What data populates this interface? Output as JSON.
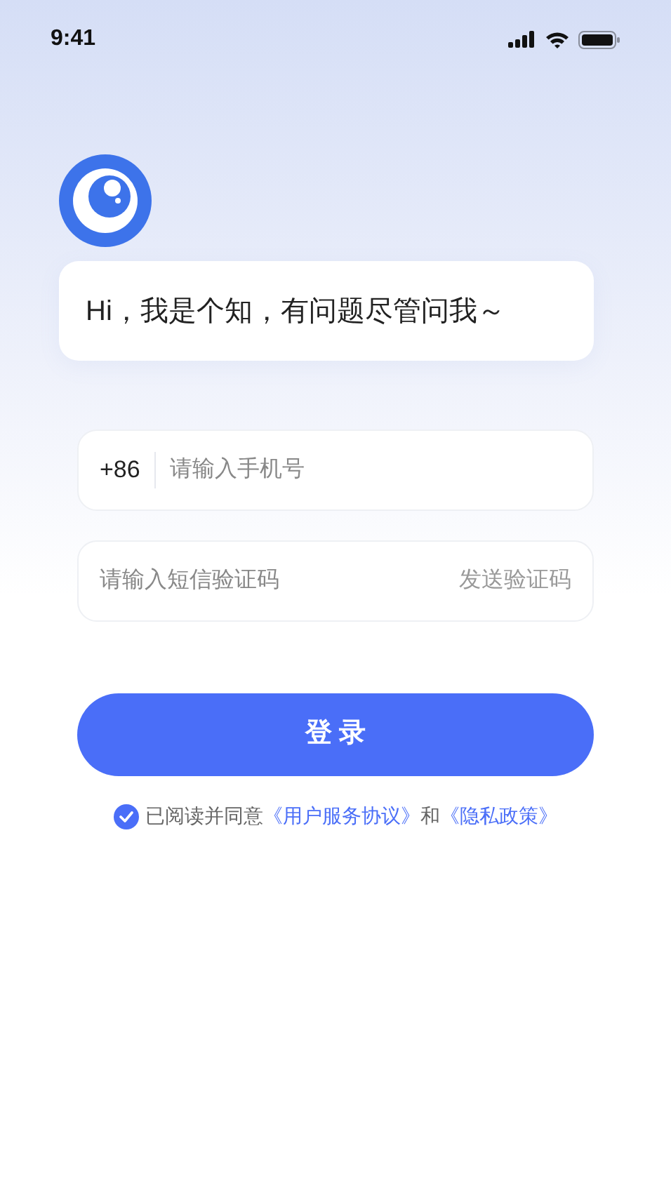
{
  "status_bar": {
    "time": "9:41"
  },
  "greeting": "Hi，我是个知，有问题尽管问我～",
  "phone_field": {
    "country_code": "+86",
    "placeholder": "请输入手机号"
  },
  "code_field": {
    "placeholder": "请输入短信验证码",
    "send_button": "发送验证码"
  },
  "login_button": "登 录",
  "agreement": {
    "checked": true,
    "text": "已阅读并同意",
    "links": [
      "《用户服务协议》",
      "《隐私政策》"
    ],
    "joiner": "和"
  }
}
